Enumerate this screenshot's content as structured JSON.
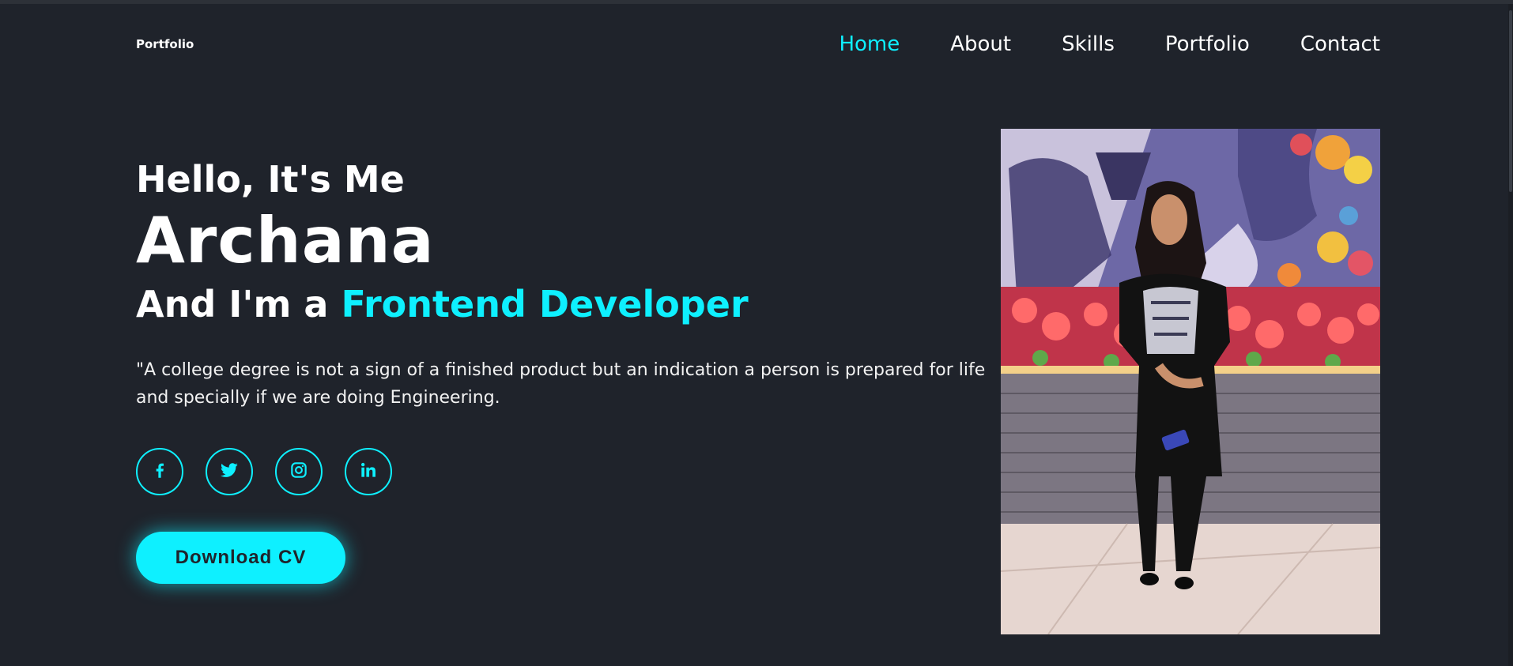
{
  "header": {
    "logo": "Portfolio",
    "nav": [
      "Home",
      "About",
      "Skills",
      "Portfolio",
      "Contact"
    ],
    "active": "Home"
  },
  "hero": {
    "greeting": "Hello, It's Me",
    "name": "Archana",
    "role_prefix": "And I'm a ",
    "role_highlight": "Frontend Developer",
    "quote": "\"A college degree is not a sign of a finished product but an indication a person is prepared for life and specially if we are doing Engineering.",
    "cta_label": "Download CV"
  },
  "socials": [
    {
      "icon": "facebook-icon"
    },
    {
      "icon": "twitter-icon"
    },
    {
      "icon": "instagram-icon"
    },
    {
      "icon": "linkedin-icon"
    }
  ],
  "colors": {
    "background": "#1f232b",
    "accent": "#0ef0ff",
    "text": "#ffffff"
  }
}
